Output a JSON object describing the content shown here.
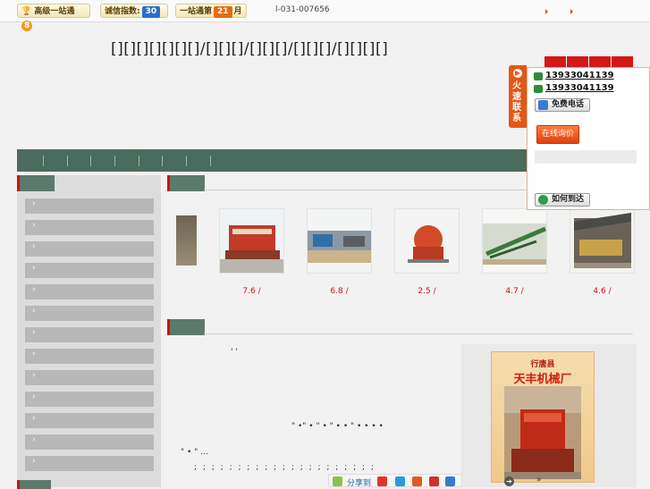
{
  "topbar": {
    "badge1_label": "高级一站通",
    "badge1_num": "8",
    "badge2_label": "诚信指数:",
    "badge2_num": "30",
    "badge3_prefix": "一站通第",
    "badge3_num": "21",
    "badge3_suffix": "月",
    "phone": "l-031-007656"
  },
  "header": {
    "title": "[][][][][][][]/[][][]/[][][]/[][][]/[][][][]"
  },
  "products": [
    {
      "price": "7.6 /"
    },
    {
      "price": "6.8 /"
    },
    {
      "price": "2.5 /"
    },
    {
      "price": "4.7 /"
    },
    {
      "price": "4.6 /"
    }
  ],
  "article": {
    "frag1": "' '",
    "frag2": "\" •\" • \" • \" • • \" • • • •",
    "frag3": "\" • \" …",
    "frag4": "; ; ; ; ; ; ; ; ; ; ; ; ; ; ; ; ; ; ; ; ;",
    "share_label": "分享到"
  },
  "ad": {
    "line1": "行唐县",
    "line2": "天丰机械厂",
    "arrows": "»"
  },
  "contact": {
    "tab_label": "火速联系",
    "phone1": "13933041139",
    "phone2": "13933041139",
    "free_call": "免费电话",
    "orange_btn": "在线询价",
    "directions": "如何到达"
  },
  "colors": {
    "nav": "#4a6b5d",
    "accent_red": "#d41717",
    "contact_orange": "#e25816"
  }
}
